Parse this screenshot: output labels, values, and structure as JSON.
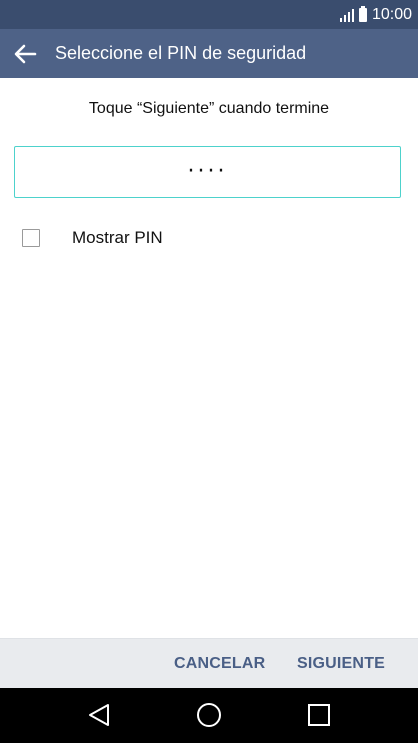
{
  "status_bar": {
    "time": "10:00",
    "icons": [
      "signal-icon",
      "battery-icon"
    ]
  },
  "app_bar": {
    "back_icon": "arrow-left-icon",
    "title": "Seleccione el PIN de seguridad"
  },
  "content": {
    "instruction": "Toque “Siguiente” cuando termine",
    "pin_field": {
      "masked_value": "····",
      "focused": true
    },
    "show_pin": {
      "label": "Mostrar PIN",
      "checked": false
    }
  },
  "actions": {
    "cancel_label": "CANCELAR",
    "next_label": "SIGUIENTE"
  },
  "nav_bar": {
    "icons": [
      "nav-back-icon",
      "nav-home-icon",
      "nav-recent-icon"
    ]
  },
  "colors": {
    "status_bar": "#3a4d6e",
    "app_bar": "#4e6287",
    "accent_field_border": "#4dd2cc",
    "action_text": "#4a5f86",
    "action_bar": "#e9ebee"
  }
}
